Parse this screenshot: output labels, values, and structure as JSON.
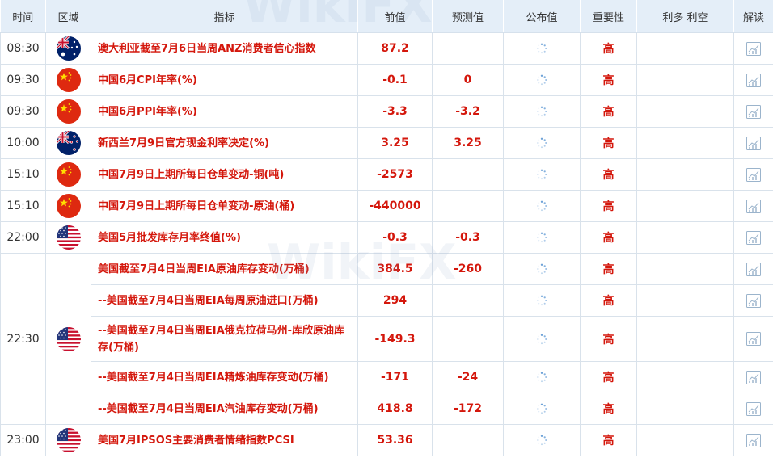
{
  "header": {
    "time": "时间",
    "region": "区域",
    "indicator": "指标",
    "previous": "前值",
    "forecast": "预测值",
    "actual": "公布值",
    "importance": "重要性",
    "impact": "利多 利空",
    "analysis": "解读"
  },
  "groups": [
    {
      "time": "08:30",
      "flag": "australia-flag",
      "rows": [
        {
          "indicator": "澳大利亚截至7月6日当周ANZ消费者信心指数",
          "previous": "87.2",
          "forecast": "",
          "importance": "高"
        }
      ]
    },
    {
      "time": "09:30",
      "flag": "china-flag",
      "rows": [
        {
          "indicator": "中国6月CPI年率(%)",
          "previous": "-0.1",
          "forecast": "0",
          "importance": "高"
        }
      ]
    },
    {
      "time": "09:30",
      "flag": "china-flag",
      "rows": [
        {
          "indicator": "中国6月PPI年率(%)",
          "previous": "-3.3",
          "forecast": "-3.2",
          "importance": "高"
        }
      ]
    },
    {
      "time": "10:00",
      "flag": "new-zealand-flag",
      "rows": [
        {
          "indicator": "新西兰7月9日官方现金利率决定(%)",
          "previous": "3.25",
          "forecast": "3.25",
          "importance": "高"
        }
      ]
    },
    {
      "time": "15:10",
      "flag": "china-flag",
      "rows": [
        {
          "indicator": "中国7月9日上期所每日仓单变动-铜(吨)",
          "previous": "-2573",
          "forecast": "",
          "importance": "高"
        }
      ]
    },
    {
      "time": "15:10",
      "flag": "china-flag",
      "rows": [
        {
          "indicator": "中国7月9日上期所每日仓单变动-原油(桶)",
          "previous": "-440000",
          "forecast": "",
          "importance": "高"
        }
      ]
    },
    {
      "time": "22:00",
      "flag": "usa-flag",
      "rows": [
        {
          "indicator": "美国5月批发库存月率终值(%)",
          "previous": "-0.3",
          "forecast": "-0.3",
          "importance": "高"
        }
      ]
    },
    {
      "time": "22:30",
      "flag": "usa-flag",
      "rows": [
        {
          "indicator": "美国截至7月4日当周EIA原油库存变动(万桶)",
          "previous": "384.5",
          "forecast": "-260",
          "importance": "高"
        },
        {
          "indicator": "--美国截至7月4日当周EIA每周原油进口(万桶)",
          "previous": "294",
          "forecast": "",
          "importance": "高"
        },
        {
          "indicator": "--美国截至7月4日当周EIA俄克拉荷马州-库欣原油库存(万桶)",
          "previous": "-149.3",
          "forecast": "",
          "importance": "高",
          "tall": true
        },
        {
          "indicator": "--美国截至7月4日当周EIA精炼油库存变动(万桶)",
          "previous": "-171",
          "forecast": "-24",
          "importance": "高"
        },
        {
          "indicator": "--美国截至7月4日当周EIA汽油库存变动(万桶)",
          "previous": "418.8",
          "forecast": "-172",
          "importance": "高"
        }
      ]
    },
    {
      "time": "23:00",
      "flag": "usa-flag",
      "rows": [
        {
          "indicator": "美国7月IPSOS主要消费者情绪指数PCSI",
          "previous": "53.36",
          "forecast": "",
          "importance": "高"
        }
      ]
    }
  ],
  "watermark": "WikiFX",
  "colors": {
    "header_bg": "#e4eef8",
    "accent_red": "#d4170c",
    "border": "#d9e2eb"
  }
}
